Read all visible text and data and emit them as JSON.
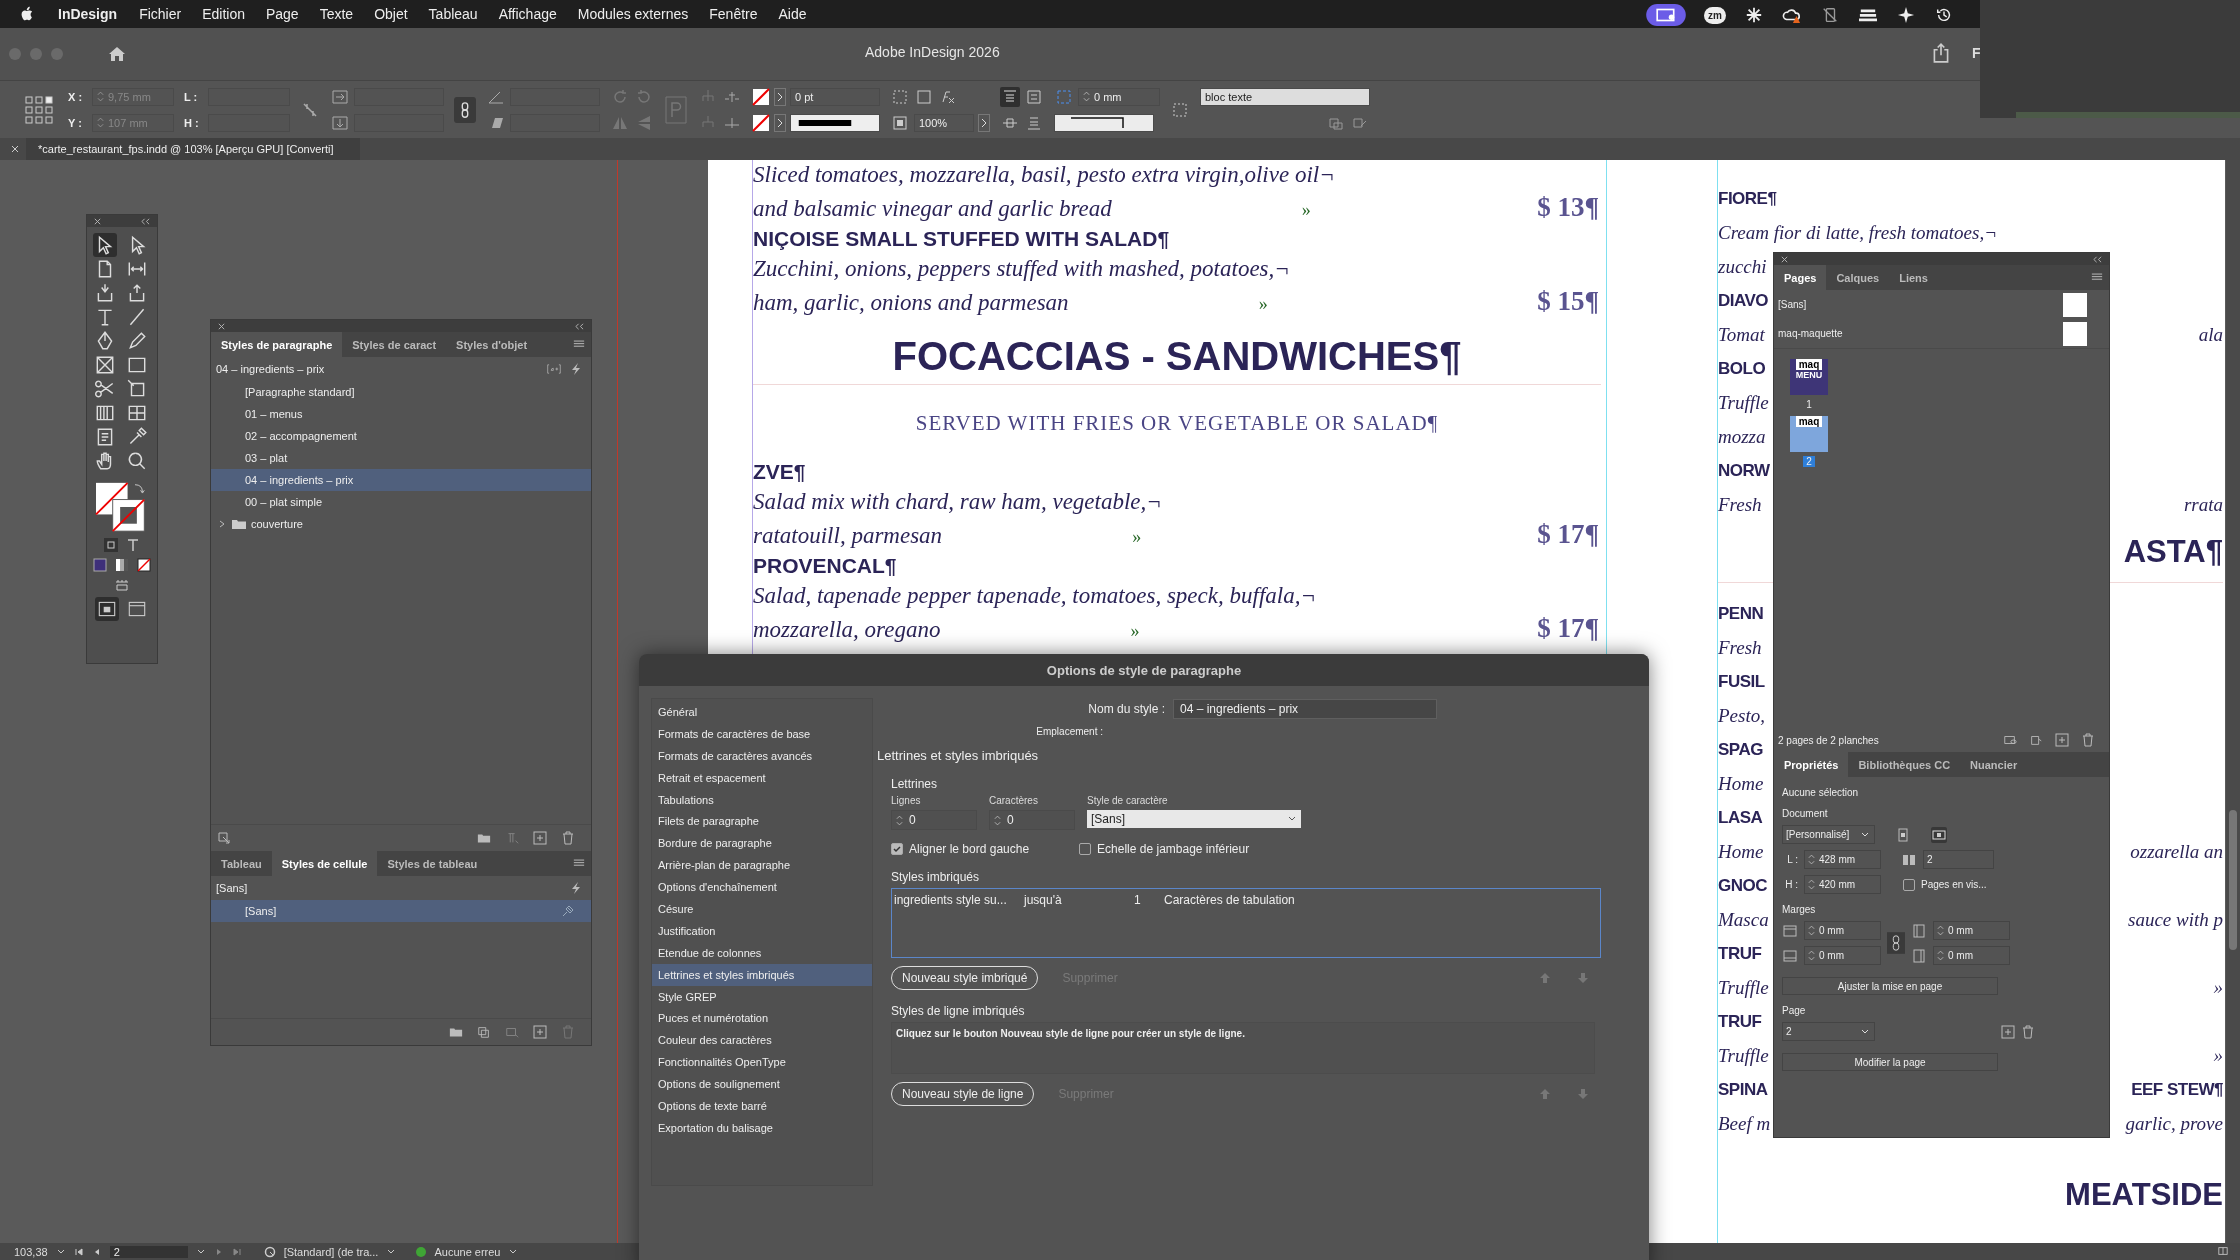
{
  "menu_bar": {
    "app_name": "InDesign",
    "items": [
      "Fichier",
      "Edition",
      "Page",
      "Texte",
      "Objet",
      "Tableau",
      "Affichage",
      "Modules externes",
      "Fenêtre",
      "Aide"
    ],
    "status_badge": "zm"
  },
  "title_bar": {
    "title": "Adobe InDesign 2026",
    "cut_label": "F"
  },
  "control_bar": {
    "x_label": "X :",
    "x_value": "9,75 mm",
    "y_label": "Y :",
    "y_value": "107 mm",
    "w_label": "L :",
    "h_label": "H :",
    "stroke_weight": "0 pt",
    "scale": "100%",
    "offset": "0 mm",
    "object_style": "bloc texte"
  },
  "document_tab": {
    "title": "*carte_restaurant_fps.indd @ 103% [Aperçu GPU] [Converti]"
  },
  "tools": [
    {
      "selected": true
    },
    {
      "selected": false
    },
    {
      "selected": false
    },
    {
      "selected": false
    },
    {
      "selected": false
    },
    {
      "selected": false
    },
    {
      "selected": false
    },
    {
      "selected": false
    },
    {
      "selected": false
    },
    {
      "selected": false
    },
    {
      "selected": false
    },
    {
      "selected": false
    },
    {
      "selected": false
    },
    {
      "selected": false
    },
    {
      "selected": false
    },
    {
      "selected": false
    },
    {
      "selected": false
    },
    {
      "selected": false
    },
    {
      "selected": false
    },
    {
      "selected": false
    }
  ],
  "view_modes": [
    {
      "selected": true
    },
    {
      "selected": false
    }
  ],
  "paragraph_styles_panel": {
    "tabs": [
      {
        "label": "Styles de paragraphe",
        "selected": true
      },
      {
        "label": "Styles de caract",
        "selected": false
      },
      {
        "label": "Styles d'objet",
        "selected": false
      }
    ],
    "current": "04 – ingredients – prix",
    "styles": [
      {
        "kind": "style",
        "label": "[Paragraphe standard]",
        "selected": false
      },
      {
        "kind": "style",
        "label": "01 – menus",
        "selected": false
      },
      {
        "kind": "style",
        "label": "02 – accompagnement",
        "selected": false
      },
      {
        "kind": "style",
        "label": "03 – plat",
        "selected": false
      },
      {
        "kind": "style",
        "label": "04 – ingredients – prix",
        "selected": true
      },
      {
        "kind": "style",
        "label": "00 – plat simple",
        "selected": false
      },
      {
        "kind": "folder",
        "label": "couverture",
        "selected": false,
        "expanded": false
      }
    ]
  },
  "cell_styles_panel": {
    "tabs": [
      {
        "label": "Tableau",
        "selected": false
      },
      {
        "label": "Styles de cellule",
        "selected": true
      },
      {
        "label": "Styles de tableau",
        "selected": false
      }
    ],
    "current": "[Sans]",
    "styles": [
      {
        "label": "[Sans]",
        "selected": true
      }
    ]
  },
  "document": {
    "left_column": [
      {
        "kind": "desc",
        "lines": [
          "Sliced tomatoes, mozzarella, basil, pesto extra virgin,olive oil¬",
          "and balsamic vinegar and garlic bread"
        ],
        "tab_mark": "»",
        "price": "$ 13¶"
      },
      {
        "kind": "heading",
        "text": "NIÇOISE SMALL STUFFED WITH SALAD¶"
      },
      {
        "kind": "desc",
        "lines": [
          "Zucchini, onions, peppers stuffed with mashed, potatoes,¬",
          "ham, garlic, onions and parmesan"
        ],
        "tab_mark": "»",
        "price": "$ 15¶"
      },
      {
        "kind": "section",
        "text": "FOCACCIAS - SANDWICHES¶"
      },
      {
        "kind": "subtitle",
        "text": "SERVED WITH FRIES OR VEGETABLE OR SALAD¶"
      },
      {
        "kind": "heading",
        "text": "ZVE¶"
      },
      {
        "kind": "desc",
        "lines": [
          "Salad mix with chard, raw ham, vegetable,¬",
          "ratatouill, parmesan"
        ],
        "tab_mark": "»",
        "price": "$ 17¶"
      },
      {
        "kind": "heading",
        "text": "PROVENCAL¶"
      },
      {
        "kind": "desc",
        "lines": [
          "Salad, tapenade pepper tapenade, tomatoes, speck, buffala,¬",
          "mozzarella, oregano"
        ],
        "tab_mark": "»",
        "price": "$ 17¶"
      }
    ],
    "right_column": [
      {
        "kind": "heading",
        "text": "FIORE¶"
      },
      {
        "kind": "desc",
        "text": "Cream fior di latte, fresh tomatoes,¬"
      },
      {
        "kind": "desc",
        "text": "zucchi"
      },
      {
        "kind": "heading",
        "text": "DIAVO"
      },
      {
        "kind": "desc",
        "text": "Tomat",
        "tail": "ala"
      },
      {
        "kind": "heading",
        "text": "BOLO"
      },
      {
        "kind": "desc",
        "text": "Truffle"
      },
      {
        "kind": "desc",
        "text": "mozza"
      },
      {
        "kind": "heading",
        "text": "NORW"
      },
      {
        "kind": "desc",
        "text": "Fresh",
        "tail": "rrata"
      },
      {
        "kind": "section",
        "tail": "ASTA¶"
      },
      {
        "kind": "heading",
        "text": "PENN"
      },
      {
        "kind": "desc",
        "text": "Fresh"
      },
      {
        "kind": "heading",
        "text": "FUSIL"
      },
      {
        "kind": "desc",
        "text": "Pesto,"
      },
      {
        "kind": "heading",
        "text": "SPAG"
      },
      {
        "kind": "desc",
        "text": "Home"
      },
      {
        "kind": "heading",
        "text": "LASA"
      },
      {
        "kind": "desc",
        "text": "Home",
        "tail": "ozzarella an"
      },
      {
        "kind": "heading",
        "text": "GNOC"
      },
      {
        "kind": "desc",
        "text": "Masca",
        "tail": "sauce with p"
      },
      {
        "kind": "heading",
        "text": "TRUF"
      },
      {
        "kind": "desc",
        "text": "Truffle",
        "tail": "»"
      },
      {
        "kind": "heading",
        "text": "TRUF"
      },
      {
        "kind": "desc",
        "text": "Truffle",
        "tail": "»"
      },
      {
        "kind": "heading",
        "text": "SPINA",
        "tail": "EEF STEW¶"
      },
      {
        "kind": "desc",
        "text": "Beef m",
        "tail": "garlic, prove"
      },
      {
        "kind": "section",
        "tail": "MEATSIDE"
      }
    ]
  },
  "dialog": {
    "title": "Options de style de paragraphe",
    "categories": [
      {
        "label": "Général",
        "selected": false
      },
      {
        "label": "Formats de caractères de base",
        "selected": false
      },
      {
        "label": "Formats de caractères avancés",
        "selected": false
      },
      {
        "label": "Retrait et espacement",
        "selected": false
      },
      {
        "label": "Tabulations",
        "selected": false
      },
      {
        "label": "Filets de paragraphe",
        "selected": false
      },
      {
        "label": "Bordure de paragraphe",
        "selected": false
      },
      {
        "label": "Arrière-plan de paragraphe",
        "selected": false
      },
      {
        "label": "Options d'enchaînement",
        "selected": false
      },
      {
        "label": "Césure",
        "selected": false
      },
      {
        "label": "Justification",
        "selected": false
      },
      {
        "label": "Etendue de colonnes",
        "selected": false
      },
      {
        "label": "Lettrines et styles imbriqués",
        "selected": true
      },
      {
        "label": "Style GREP",
        "selected": false
      },
      {
        "label": "Puces et numérotation",
        "selected": false
      },
      {
        "label": "Couleur des caractères",
        "selected": false
      },
      {
        "label": "Fonctionnalités OpenType",
        "selected": false
      },
      {
        "label": "Options de soulignement",
        "selected": false
      },
      {
        "label": "Options de texte barré",
        "selected": false
      },
      {
        "label": "Exportation du balisage",
        "selected": false
      }
    ],
    "style_name_label": "Nom du style :",
    "style_name": "04 – ingredients – prix",
    "location_label": "Emplacement :",
    "section_title": "Lettrines et styles imbriqués",
    "drop_caps": {
      "title": "Lettrines",
      "lines_label": "Lignes",
      "lines": "0",
      "chars_label": "Caractères",
      "chars": "0",
      "char_style_label": "Style de caractère",
      "char_style": "[Sans]",
      "align_left": {
        "label": "Aligner le bord gauche",
        "checked": true
      },
      "scale_descenders": {
        "label": "Echelle de jambage inférieur",
        "checked": false
      }
    },
    "nested_styles": {
      "title": "Styles imbriqués",
      "rows": [
        {
          "style": "ingredients style su...",
          "mode": "jusqu'à",
          "count": "1",
          "until": "Caractères de tabulation"
        }
      ],
      "new_button": "Nouveau style imbriqué",
      "delete_button": {
        "label": "Supprimer",
        "disabled": true
      }
    },
    "line_styles": {
      "title": "Styles de ligne imbriqués",
      "hint": "Cliquez sur le bouton Nouveau style de ligne pour créer un style de ligne.",
      "new_button": "Nouveau style de ligne",
      "delete_button": {
        "label": "Supprimer",
        "disabled": true
      }
    }
  },
  "pages_panel": {
    "tabs": [
      {
        "label": "Pages",
        "selected": true
      },
      {
        "label": "Calques",
        "selected": false
      },
      {
        "label": "Liens",
        "selected": false
      }
    ],
    "masters": [
      "[Sans]",
      "maq-maquette"
    ],
    "pages": [
      {
        "number": "1",
        "master": "maq",
        "thumb_label": "MENU",
        "selected": false
      },
      {
        "number": "2",
        "master": "maq",
        "selected": true
      }
    ],
    "summary": "2 pages de 2 planches"
  },
  "properties_panel": {
    "tabs": [
      {
        "label": "Propriétés",
        "selected": true
      },
      {
        "label": "Bibliothèques CC",
        "selected": false
      },
      {
        "label": "Nuancier",
        "selected": false
      }
    ],
    "selection": "Aucune sélection",
    "document_title": "Document",
    "preset": "[Personnalisé]",
    "orientations": [
      {
        "selected": false
      },
      {
        "selected": true
      }
    ],
    "width_label": "L :",
    "width": "428 mm",
    "height_label": "H :",
    "height": "420 mm",
    "page_count": "2",
    "facing_pages": {
      "label": "Pages en vis...",
      "checked": false
    },
    "margins_title": "Marges",
    "margins": [
      "0 mm",
      "0 mm",
      "0 mm",
      "0 mm"
    ],
    "adjust_button": "Ajuster la mise en page",
    "page_title": "Page",
    "page": "2",
    "edit_button": "Modifier la page"
  },
  "status_bar": {
    "zoom": "103,38",
    "page": "2",
    "preflight_profile": "[Standard] (de tra...",
    "preflight": {
      "label": "Aucune erreu",
      "color": "#3fa535"
    }
  }
}
